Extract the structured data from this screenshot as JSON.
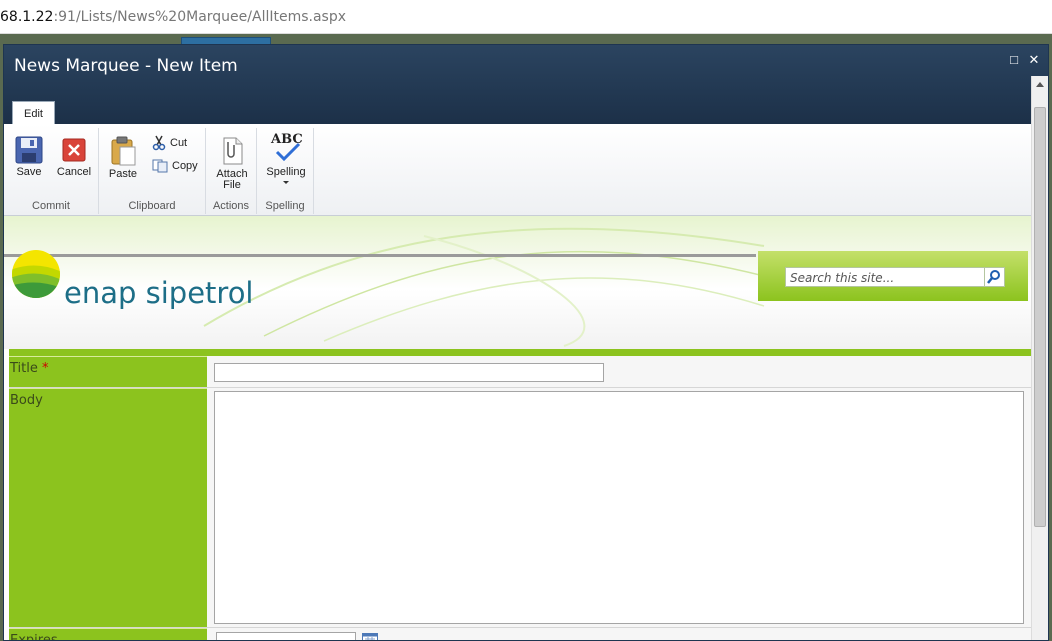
{
  "address_bar": {
    "url_host": "68.1.22",
    "url_rest": ":91/Lists/News%20Marquee/AllItems.aspx"
  },
  "dialog": {
    "title": "News Marquee - New Item",
    "maximize_glyph": "□",
    "close_glyph": "✕"
  },
  "ribbon": {
    "tab": "Edit",
    "groups": {
      "commit": {
        "label": "Commit",
        "save": "Save",
        "cancel": "Cancel"
      },
      "clipboard": {
        "label": "Clipboard",
        "paste": "Paste",
        "cut": "Cut",
        "copy": "Copy"
      },
      "actions": {
        "label": "Actions",
        "attach_line1": "Attach",
        "attach_line2": "File"
      },
      "spelling": {
        "label": "Spelling",
        "spelling": "Spelling",
        "abc": "ABC"
      }
    }
  },
  "banner": {
    "brand": "enap sipetrol",
    "search_placeholder": "Search this site..."
  },
  "form": {
    "title_label": "Title",
    "required_mark": "*",
    "body_label": "Body",
    "expires_label": "Expires"
  },
  "colors": {
    "accent_green": "#8cc31e",
    "titlebar": "#1c3048",
    "brand_teal": "#1d6e87"
  },
  "icons": [
    "save-icon",
    "cancel-icon",
    "paste-icon",
    "cut-icon",
    "copy-icon",
    "attach-file-icon",
    "spelling-icon",
    "search-icon",
    "calendar-icon"
  ]
}
